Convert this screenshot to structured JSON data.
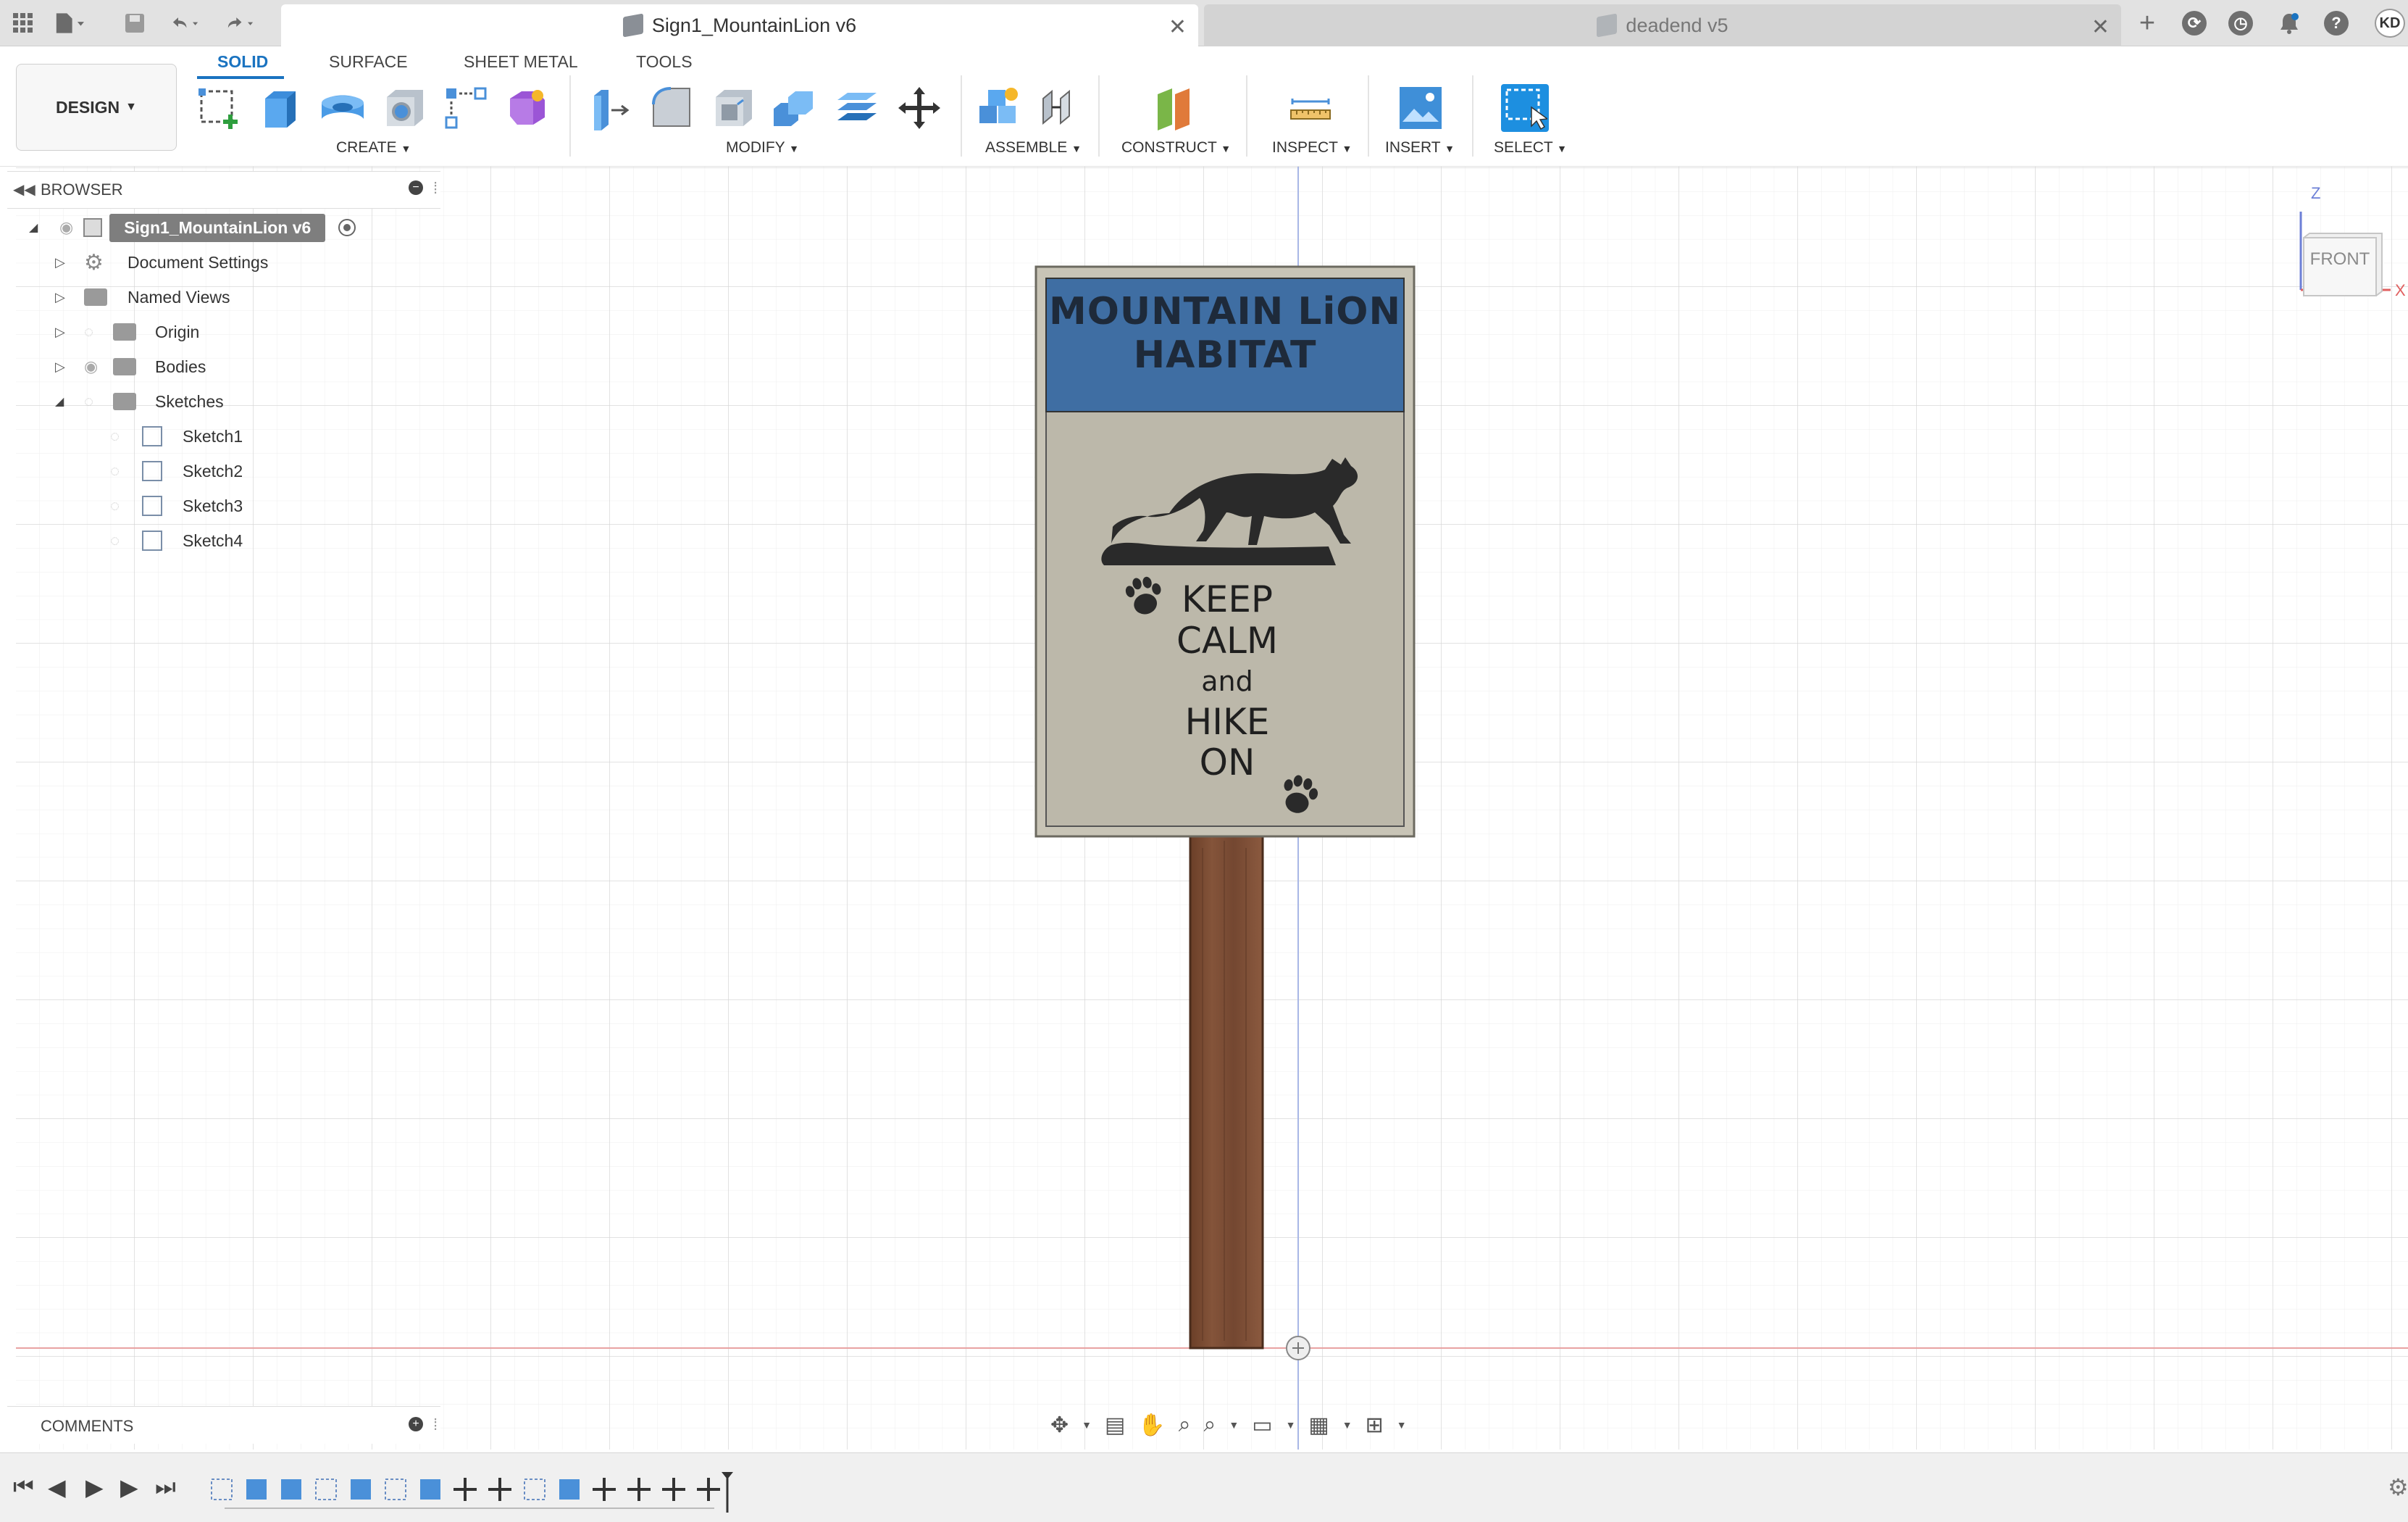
{
  "titlebar": {
    "active_tab": "Sign1_MountainLion v6",
    "inactive_tab": "deadend v5",
    "user_initials": "KD"
  },
  "toolbar": {
    "workspace_button": "DESIGN",
    "tabs": [
      "SOLID",
      "SURFACE",
      "SHEET METAL",
      "TOOLS"
    ],
    "groups": {
      "create": "CREATE",
      "modify": "MODIFY",
      "assemble": "ASSEMBLE",
      "construct": "CONSTRUCT",
      "inspect": "INSPECT",
      "insert": "INSERT",
      "select": "SELECT"
    }
  },
  "browser": {
    "title": "BROWSER",
    "root": "Sign1_MountainLion v6",
    "items": [
      "Document Settings",
      "Named Views",
      "Origin",
      "Bodies",
      "Sketches"
    ],
    "sketches": [
      "Sketch1",
      "Sketch2",
      "Sketch3",
      "Sketch4"
    ]
  },
  "comments": {
    "title": "COMMENTS"
  },
  "viewcube": {
    "face": "FRONT",
    "axis_z": "Z",
    "axis_x": "X"
  },
  "sign": {
    "header_line1": "MOUNTAIN LiON",
    "header_line2": "HABITAT",
    "body_lines": [
      "KEEP",
      "CALM",
      "and",
      "HIKE",
      "ON"
    ]
  },
  "colors": {
    "sign_header": "#3f6ea3",
    "sign_panel": "#bcb8aa",
    "post": "#7a4a31",
    "accent": "#1a73c0"
  }
}
